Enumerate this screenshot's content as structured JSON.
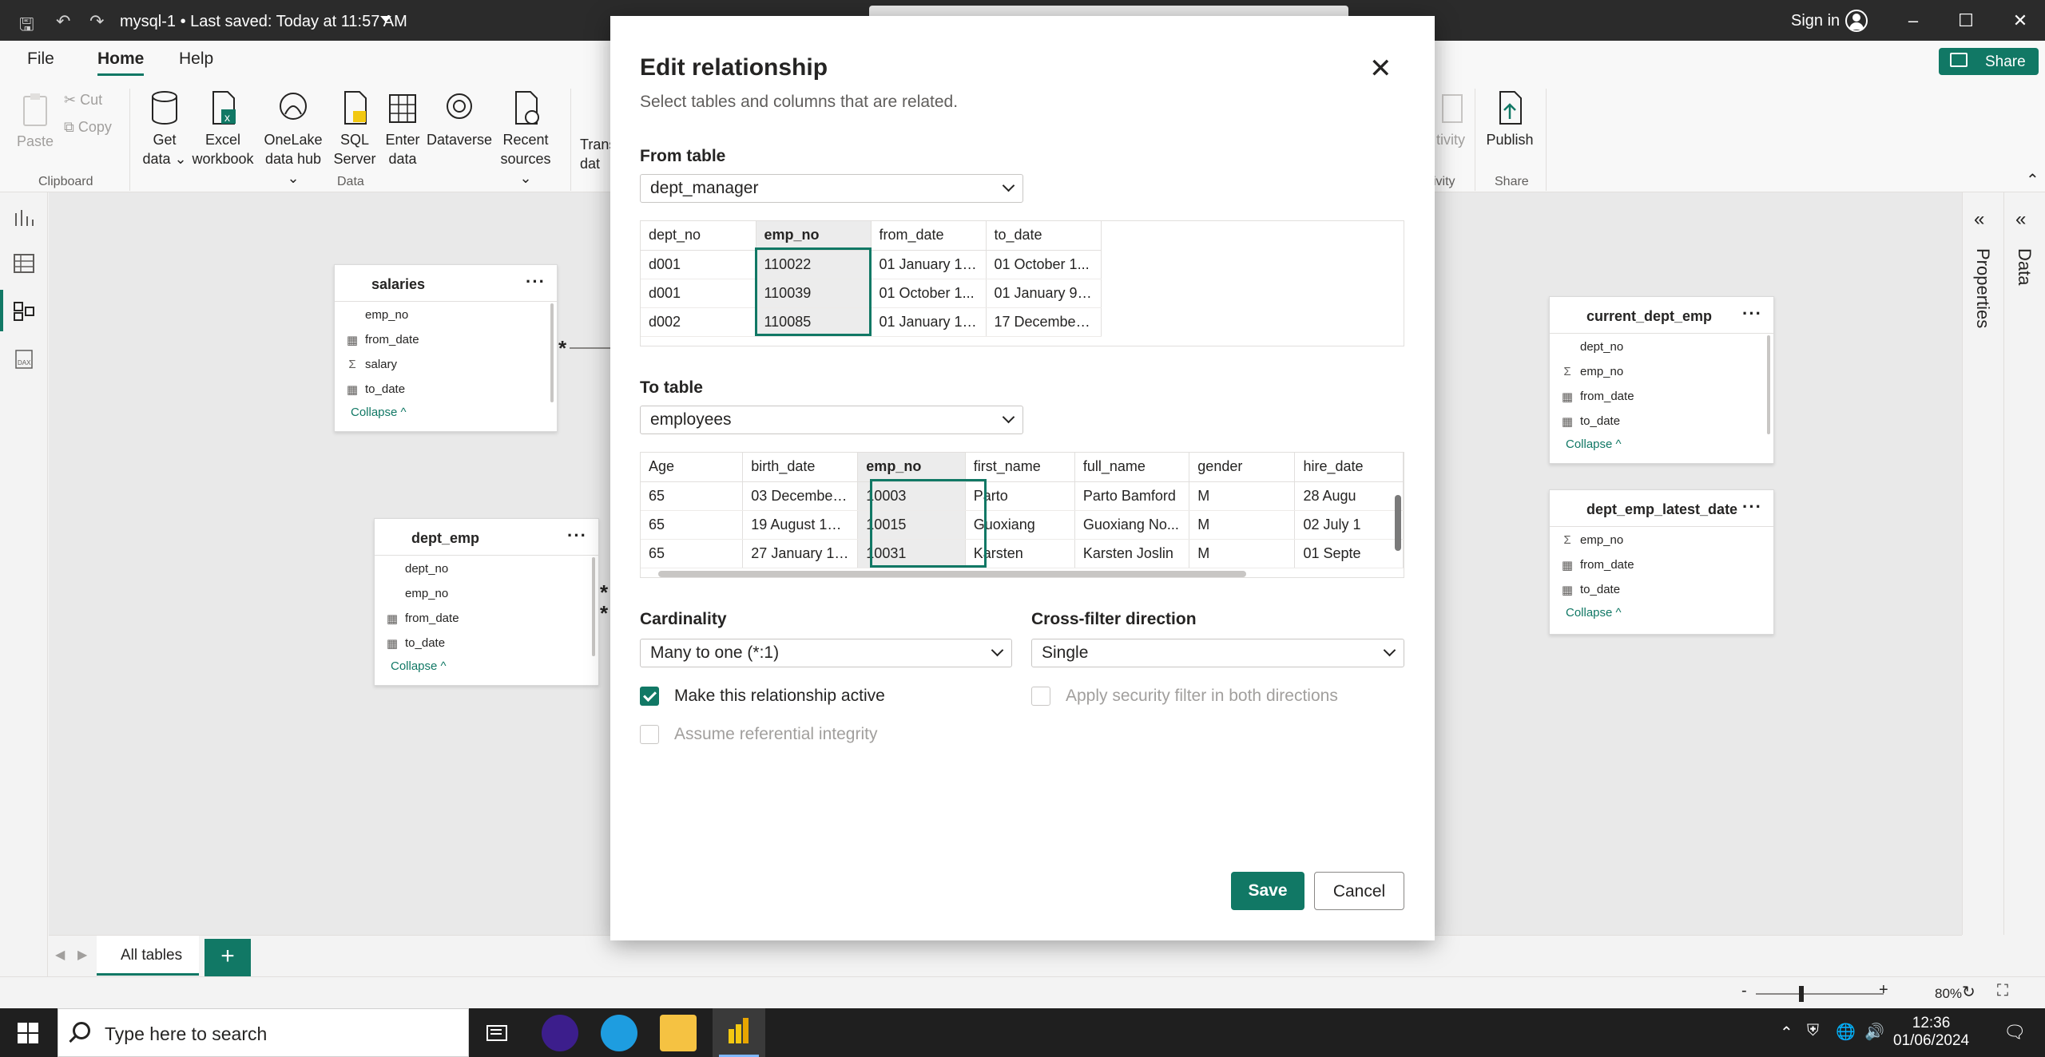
{
  "titlebar": {
    "title": "mysql-1 • Last saved: Today at 11:57 AM",
    "signin": "Sign in"
  },
  "ribbon": {
    "tabs": [
      "File",
      "Home",
      "Help"
    ],
    "share_label": "Share",
    "clipboard": {
      "paste": "Paste",
      "cut": "Cut",
      "copy": "Copy",
      "group": "Clipboard"
    },
    "data_items": [
      {
        "line1": "Get",
        "line2": "data ⌄"
      },
      {
        "line1": "Excel",
        "line2": "workbook"
      },
      {
        "line1": "OneLake",
        "line2": "data hub ⌄"
      },
      {
        "line1": "SQL",
        "line2": "Server"
      },
      {
        "line1": "Enter",
        "line2": "data"
      },
      {
        "line1": "Dataverse",
        "line2": ""
      },
      {
        "line1": "Recent",
        "line2": "sources ⌄"
      }
    ],
    "data_group": "Data",
    "trans_line1": "Trans",
    "trans_line2": "dat",
    "sensitivity": "tivity",
    "sensitivity_group": "ivity",
    "publish": "Publish",
    "share_group": "Share"
  },
  "canvas": {
    "cards": [
      {
        "title": "salaries",
        "fields": [
          {
            "icon": "",
            "name": "emp_no"
          },
          {
            "icon": "▦",
            "name": "from_date"
          },
          {
            "icon": "Σ",
            "name": "salary"
          },
          {
            "icon": "▦",
            "name": "to_date"
          }
        ],
        "collapse": "Collapse ^"
      },
      {
        "title": "dept_emp",
        "fields": [
          {
            "icon": "",
            "name": "dept_no"
          },
          {
            "icon": "",
            "name": "emp_no"
          },
          {
            "icon": "▦",
            "name": "from_date"
          },
          {
            "icon": "▦",
            "name": "to_date"
          }
        ],
        "collapse": "Collapse ^"
      },
      {
        "title": "current_dept_emp",
        "fields": [
          {
            "icon": "",
            "name": "dept_no"
          },
          {
            "icon": "Σ",
            "name": "emp_no"
          },
          {
            "icon": "▦",
            "name": "from_date"
          },
          {
            "icon": "▦",
            "name": "to_date"
          }
        ],
        "collapse": "Collapse ^"
      },
      {
        "title": "dept_emp_latest_date",
        "fields": [
          {
            "icon": "Σ",
            "name": "emp_no"
          },
          {
            "icon": "▦",
            "name": "from_date"
          },
          {
            "icon": "▦",
            "name": "to_date"
          }
        ],
        "collapse": "Collapse ^"
      }
    ],
    "star": "*"
  },
  "panes": {
    "properties": "Properties",
    "data": "Data"
  },
  "bottom": {
    "page_tab": "All tables",
    "add": "+",
    "zoom": "80%"
  },
  "dialog": {
    "title": "Edit relationship",
    "subtitle": "Select tables and columns that are related.",
    "from_label": "From table",
    "from_table": "dept_manager",
    "from_grid": {
      "columns": [
        "dept_no",
        "emp_no",
        "from_date",
        "to_date"
      ],
      "rows": [
        [
          "d001",
          "110022",
          "01 January 19...",
          "01 October 1..."
        ],
        [
          "d001",
          "110039",
          "01 October 1...",
          "01 January 99..."
        ],
        [
          "d002",
          "110085",
          "01 January 19...",
          "17 December ..."
        ]
      ]
    },
    "to_label": "To table",
    "to_table": "employees",
    "to_grid": {
      "columns": [
        "Age",
        "birth_date",
        "emp_no",
        "first_name",
        "full_name",
        "gender",
        "hire_date"
      ],
      "rows": [
        [
          "65",
          "03 December ...",
          "10003",
          "Parto",
          "Parto Bamford",
          "M",
          "28 Augu"
        ],
        [
          "65",
          "19 August 1959",
          "10015",
          "Guoxiang",
          "Guoxiang No...",
          "M",
          "02 July 1"
        ],
        [
          "65",
          "27 January 19...",
          "10031",
          "Karsten",
          "Karsten Joslin",
          "M",
          "01 Septe"
        ]
      ]
    },
    "cardinality_label": "Cardinality",
    "cardinality": "Many to one (*:1)",
    "crossfilter_label": "Cross-filter direction",
    "crossfilter": "Single",
    "active_label": "Make this relationship active",
    "integrity_label": "Assume referential integrity",
    "security_label": "Apply security filter in both directions",
    "save": "Save",
    "cancel": "Cancel"
  },
  "taskbar": {
    "search_placeholder": "Type here to search",
    "time": "12:36",
    "date": "01/06/2024"
  },
  "colors": {
    "accent": "#117865",
    "titlebar": "#2b2b2b",
    "taskbar": "#1f1f1f"
  }
}
